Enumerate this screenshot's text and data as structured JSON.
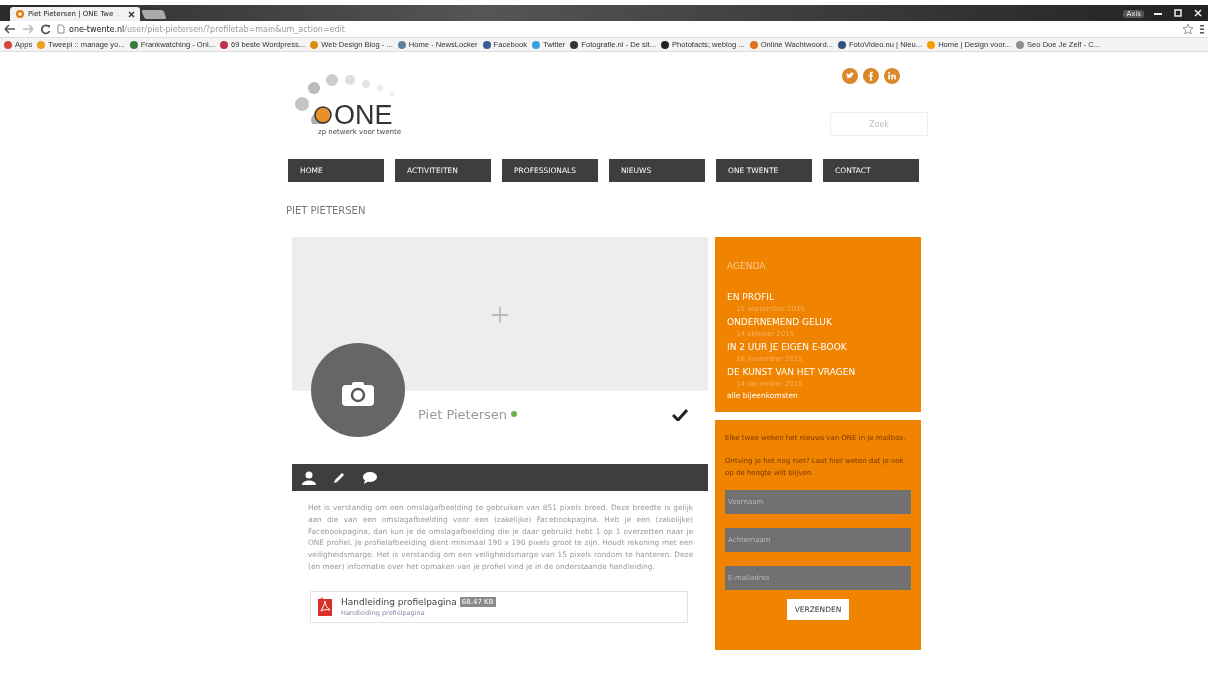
{
  "browser": {
    "tabs": [
      {
        "title": "Piet Pietersen | ONE Twe",
        "selected": true
      }
    ],
    "profile_badge": "Axis",
    "url": {
      "host": "one-twente.nl",
      "path": "/user/piet-pietersen/?profiletab=main&um_action=edit"
    },
    "bookmarks": [
      {
        "label": "Apps",
        "color": "#d04a3a"
      },
      {
        "label": "Tweepi :: manage yo...",
        "color": "#e8a020"
      },
      {
        "label": "Frankwatching - Onl...",
        "color": "#3a7a3a"
      },
      {
        "label": "69 beste Wordpress...",
        "color": "#c03050"
      },
      {
        "label": "Web Design Blog - ...",
        "color": "#d89010"
      },
      {
        "label": "Home - NewsLocker",
        "color": "#6080a0"
      },
      {
        "label": "Facebook",
        "color": "#3b5998"
      },
      {
        "label": "Twitter",
        "color": "#3aa0e0"
      },
      {
        "label": "Fotografie.nl - De sit...",
        "color": "#333333"
      },
      {
        "label": "Photofacts; weblog ...",
        "color": "#222222"
      },
      {
        "label": "Online Wachtwoord...",
        "color": "#e07020"
      },
      {
        "label": "FotoVideo.nu | Nieu...",
        "color": "#305080"
      },
      {
        "label": "Home | Design voor...",
        "color": "#f0a000"
      },
      {
        "label": "Seo Doe Je Zelf - C...",
        "color": "#909090"
      }
    ]
  },
  "site": {
    "logo": {
      "name": "ONE",
      "tagline": "zp netwerk voor twente"
    },
    "search": {
      "placeholder": "Zoek"
    },
    "nav": [
      "HOME",
      "ACTIVITEITEN",
      "PROFESSIONALS",
      "NIEUWS",
      "ONE TWENTE",
      "CONTACT"
    ],
    "page_title": "PIET PIETERSEN",
    "profile": {
      "name": "Piet Pietersen",
      "online": true,
      "tabs": [
        {
          "kind": "user"
        },
        {
          "kind": "edit"
        },
        {
          "kind": "comment"
        }
      ],
      "description": "Het is verstandig om een omslagafbeelding te gebruiken van 851 pixels breed. Deze breedte is gelijk aan die van een omslagafbeelding voor een (zakelijke) Facebookpagina. Heb je een (zakelijke) Facebookpagina, dan kun je de omslagafbeelding die je daar gebruikt hebt 1 op 1 overzetten naar je ONE profiel. Je profielafbeelding dient minimaal 190 x 190 pixels groot te zijn. Houdt rekening met een veiligheidsmarge. Het is verstandig om een veiligheidsmarge van 15 pixels rondom te hanteren. Deze (en meer) informatie over het opmaken van je profiel vind je in de onderstaande handleiding.",
      "attachment": {
        "title": "Handleiding profielpagina",
        "size": "68.47 KB",
        "link": "Handleiding profielpagina"
      }
    },
    "agenda": {
      "title": "AGENDA",
      "events": [
        {
          "title": "EN PROFIL",
          "date": "15 september 2015"
        },
        {
          "title": "ONDERNEMEND GELUK",
          "date": "14 oktober 2015"
        },
        {
          "title": "IN 2 UUR JE EIGEN E-BOOK",
          "date": "18 november 2015"
        },
        {
          "title": "DE KUNST VAN HET VRAGEN",
          "date": "14 december 2015"
        }
      ],
      "more_link": "alle bijeenkomsten"
    },
    "newsletter": {
      "paragraphs": [
        "Elke twee weken het nieuws van ONE in je mailbox.",
        "Ontving je het nog niet? Laat hier weten dat je ook op de hoogte wilt blijven."
      ],
      "fields": [
        {
          "placeholder": "Voornaam"
        },
        {
          "placeholder": "Achternaam"
        },
        {
          "placeholder": "E-mailadres"
        }
      ],
      "button": "VERZENDEN"
    }
  }
}
